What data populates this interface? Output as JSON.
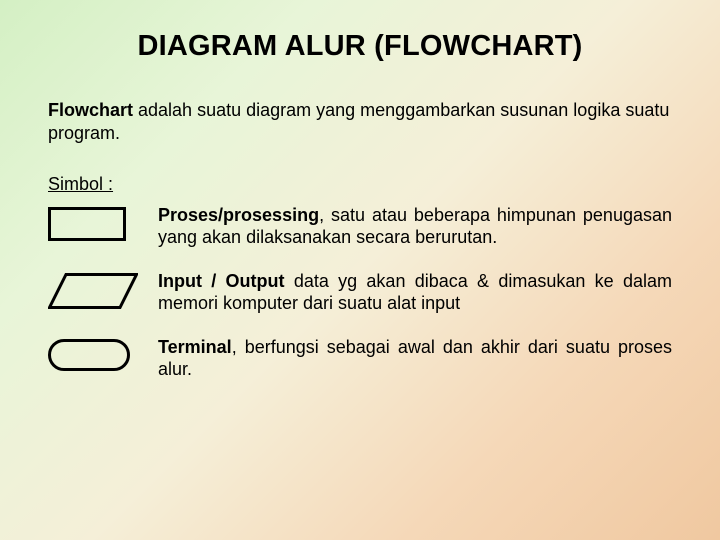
{
  "title": "DIAGRAM ALUR (FLOWCHART)",
  "definition": {
    "lead": "Flowchart",
    "rest": " adalah suatu diagram yang menggambarkan susunan logika suatu program."
  },
  "symbol_header": "Simbol :",
  "symbols": [
    {
      "shape": "rectangle",
      "lead": "Proses/prosessing",
      "rest": ", satu atau beberapa himpunan penugasan yang akan dilaksanakan secara berurutan."
    },
    {
      "shape": "parallelogram",
      "lead": "Input / Output",
      "rest": " data yg akan dibaca & dimasukan ke dalam memori komputer dari suatu alat input"
    },
    {
      "shape": "stadium",
      "lead": "Terminal",
      "rest": ", berfungsi sebagai awal dan akhir dari suatu proses alur."
    }
  ]
}
